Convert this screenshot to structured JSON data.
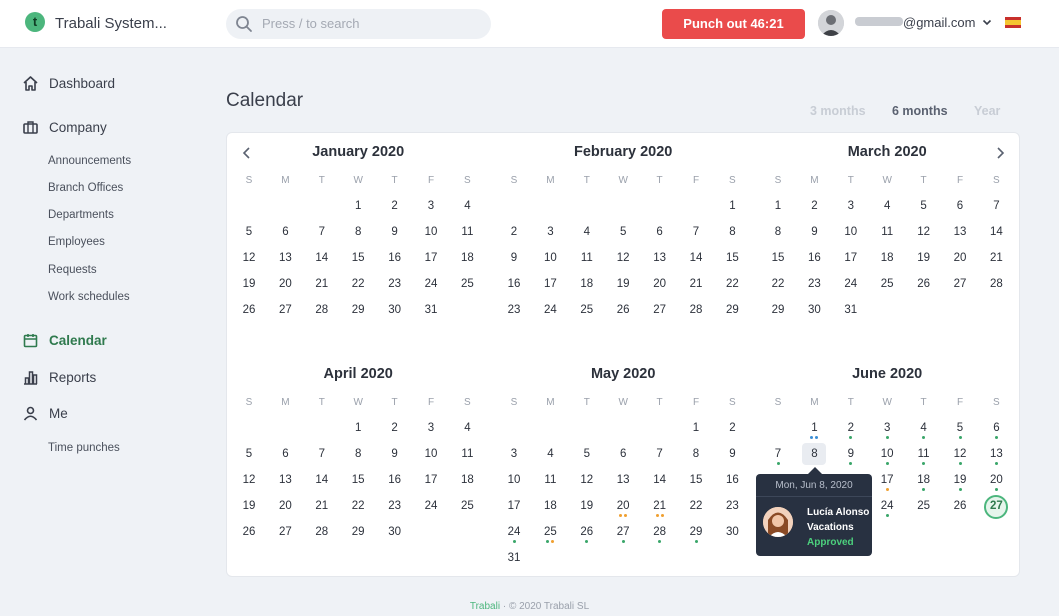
{
  "app": {
    "name": "Trabali System...",
    "logo_letter": "t",
    "accent": "#4cb67d"
  },
  "search": {
    "placeholder": "Press / to search"
  },
  "punch_button": {
    "label": "Punch out 46:21",
    "color": "#ea4b4b"
  },
  "user": {
    "email_visible": "@gmail.com",
    "language_flag": "spain-flag-icon"
  },
  "sidebar": {
    "items": [
      {
        "label": "Dashboard",
        "icon": "home-icon"
      },
      {
        "label": "Company",
        "icon": "briefcase-icon"
      },
      {
        "label": "Calendar",
        "icon": "calendar-icon",
        "active": true
      },
      {
        "label": "Reports",
        "icon": "bar-chart-icon"
      },
      {
        "label": "Me",
        "icon": "user-icon"
      }
    ],
    "company_sub": [
      "Announcements",
      "Branch Offices",
      "Departments",
      "Employees",
      "Requests",
      "Work schedules"
    ],
    "me_sub": [
      "Time punches"
    ]
  },
  "page": {
    "title": "Calendar",
    "ranges": [
      {
        "label": "3 months",
        "active": false
      },
      {
        "label": "6 months",
        "active": true
      },
      {
        "label": "Year",
        "active": false
      }
    ]
  },
  "calendar": {
    "weekdays": [
      "S",
      "M",
      "T",
      "W",
      "T",
      "F",
      "S"
    ],
    "months": [
      {
        "title": "January 2020",
        "start": 3,
        "days": 31
      },
      {
        "title": "February 2020",
        "start": 6,
        "days": 29
      },
      {
        "title": "March 2020",
        "start": 0,
        "days": 31
      },
      {
        "title": "April 2020",
        "start": 3,
        "days": 30
      },
      {
        "title": "May 2020",
        "start": 5,
        "days": 31
      },
      {
        "title": "June 2020",
        "start": 1,
        "days": 30
      }
    ],
    "event_dots": {
      "May 2020": {
        "20": [
          "#f0a030",
          "#f0a030"
        ],
        "21": [
          "#f0a030",
          "#f0a030"
        ],
        "24": [
          "#3aa66a"
        ],
        "25": [
          "#3aa66a",
          "#f0a030"
        ],
        "26": [
          "#3aa66a"
        ],
        "27": [
          "#3aa66a"
        ],
        "28": [
          "#3aa66a"
        ],
        "29": [
          "#3aa66a"
        ]
      },
      "June 2020": {
        "1": [
          "#3b8ed6",
          "#3b8ed6"
        ],
        "2": [
          "#3aa66a"
        ],
        "3": [
          "#3aa66a"
        ],
        "4": [
          "#3aa66a"
        ],
        "5": [
          "#3aa66a"
        ],
        "6": [
          "#3aa66a"
        ],
        "7": [
          "#3aa66a"
        ],
        "9": [
          "#3aa66a"
        ],
        "10": [
          "#3aa66a"
        ],
        "11": [
          "#3aa66a"
        ],
        "12": [
          "#3aa66a"
        ],
        "13": [
          "#3aa66a"
        ],
        "16": [
          "#3aa66a"
        ],
        "17": [
          "#f0a030"
        ],
        "18": [
          "#3aa66a"
        ],
        "19": [
          "#3aa66a"
        ],
        "20": [
          "#3aa66a"
        ],
        "24": [
          "#3aa66a"
        ]
      }
    },
    "selected": {
      "month": "June 2020",
      "day": 8
    },
    "today": {
      "month": "June 2020",
      "day": 27
    }
  },
  "tooltip": {
    "date": "Mon, Jun 8, 2020",
    "name": "Lucía Alonso",
    "type": "Vacations",
    "status": "Approved",
    "status_color": "#4cd07d"
  },
  "footer": {
    "brand": "Trabali",
    "separator": " · ",
    "copyright": "© 2020 Trabali SL"
  }
}
